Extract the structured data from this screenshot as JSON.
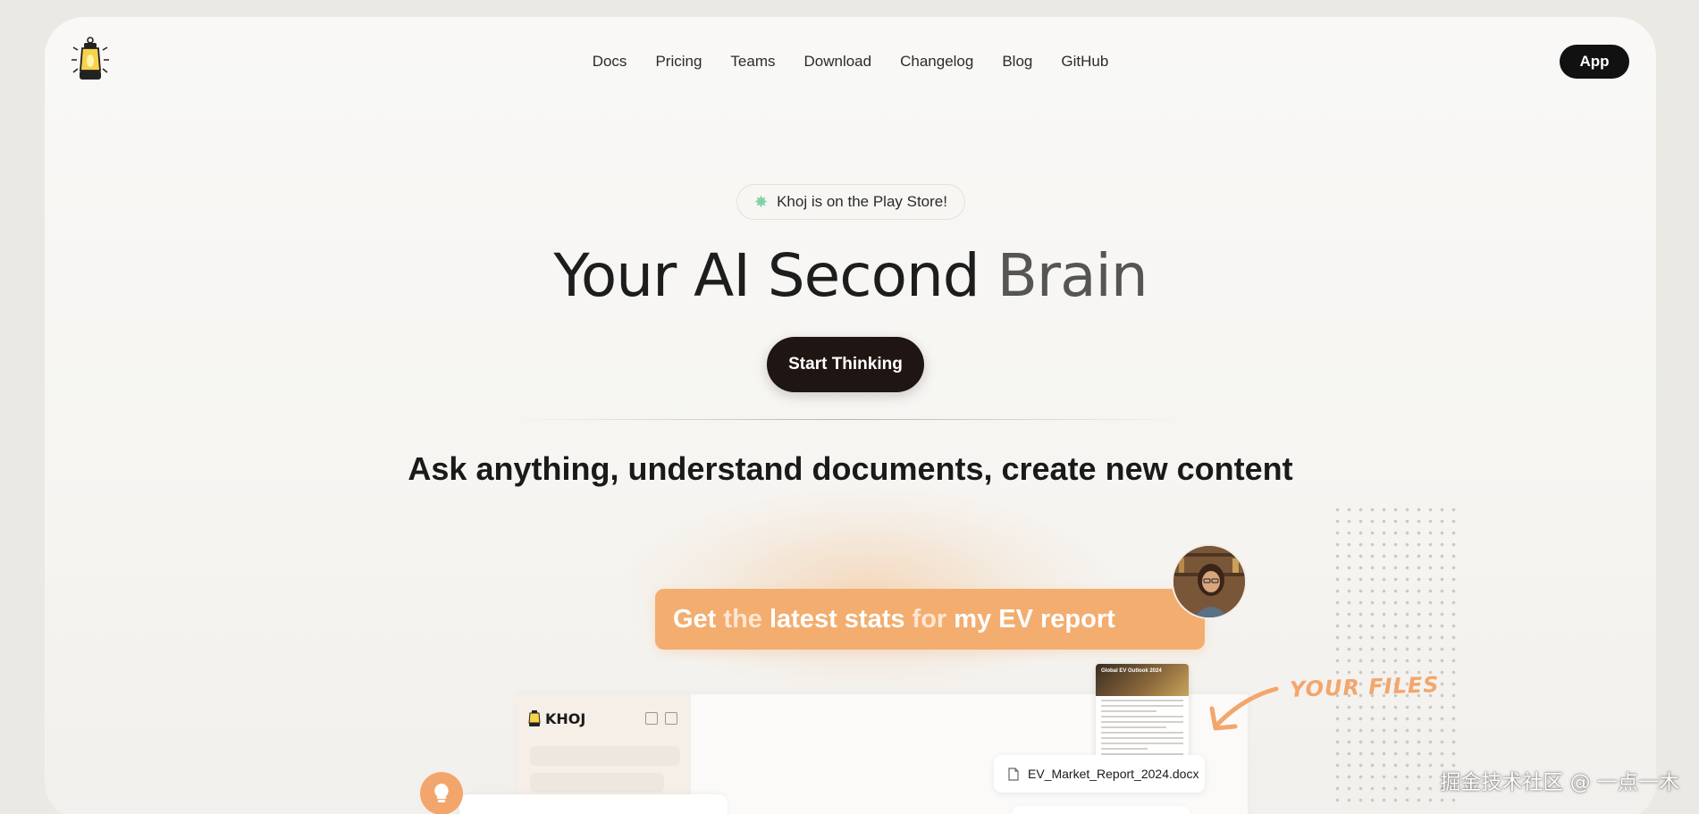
{
  "nav": {
    "items": [
      "Docs",
      "Pricing",
      "Teams",
      "Download",
      "Changelog",
      "Blog",
      "GitHub"
    ],
    "app_label": "App"
  },
  "hero": {
    "badge_text": "Khoj is on the Play Store!",
    "headline_dark": "Your AI Second",
    "headline_light": "Brain",
    "cta_label": "Start Thinking",
    "subheading": "Ask anything, understand documents, create new content"
  },
  "demo": {
    "prompt_part1": "Get",
    "prompt_part2": "the",
    "prompt_part3": "latest stats",
    "prompt_part4": "for",
    "prompt_part5": "my EV report",
    "app_brand": "KHOJ",
    "doc_title": "Global EV Outlook 2024",
    "file_name": "EV_Market_Report_2024.docx",
    "annotation": "YOUR FILES"
  },
  "watermark": "掘金技术社区 @ 一点一木",
  "colors": {
    "accent_orange": "#f3ad6f",
    "cta_bg": "#1f1512",
    "app_btn_bg": "#111111",
    "badge_star": "#7fd3a7"
  }
}
